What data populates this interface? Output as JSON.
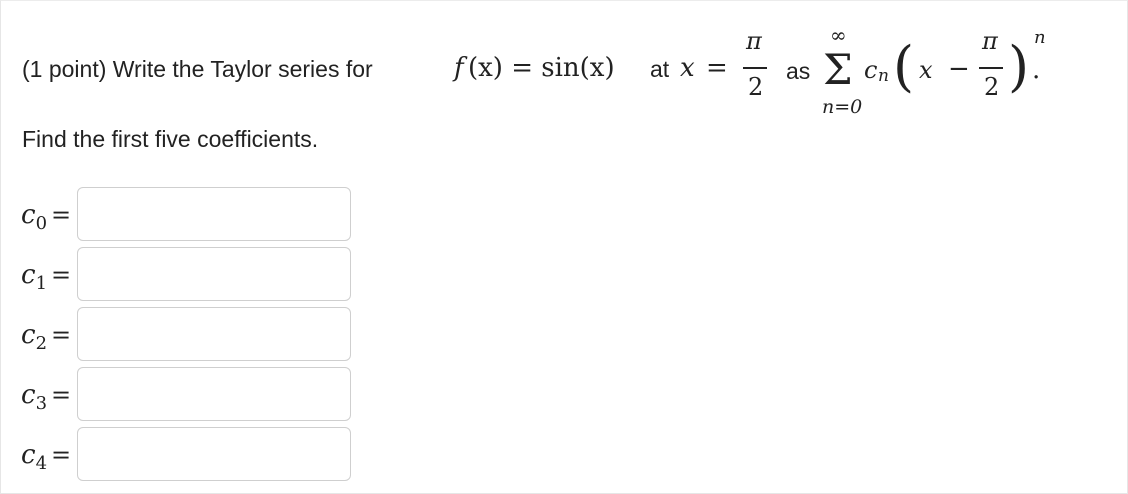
{
  "problem": {
    "points": "(1 point) Write the Taylor series for",
    "function_f": "f",
    "function_rest": "(x) = sin(x)",
    "at_text": "at",
    "at_var": "x",
    "at_eq": "=",
    "pi": "π",
    "two": "2",
    "as_text": "as",
    "sum_top": "∞",
    "sum_symbol": "Σ",
    "sum_bottom": "n=0",
    "coef": "c",
    "coef_sub": "n",
    "paren_x": "x",
    "minus": "−",
    "exponent": "n",
    "period": "."
  },
  "subtitle": "Find the first five coefficients.",
  "coefficients": [
    {
      "var": "c",
      "sub": "0",
      "eq": "=",
      "value": ""
    },
    {
      "var": "c",
      "sub": "1",
      "eq": "=",
      "value": ""
    },
    {
      "var": "c",
      "sub": "2",
      "eq": "=",
      "value": ""
    },
    {
      "var": "c",
      "sub": "3",
      "eq": "=",
      "value": ""
    },
    {
      "var": "c",
      "sub": "4",
      "eq": "=",
      "value": ""
    }
  ]
}
